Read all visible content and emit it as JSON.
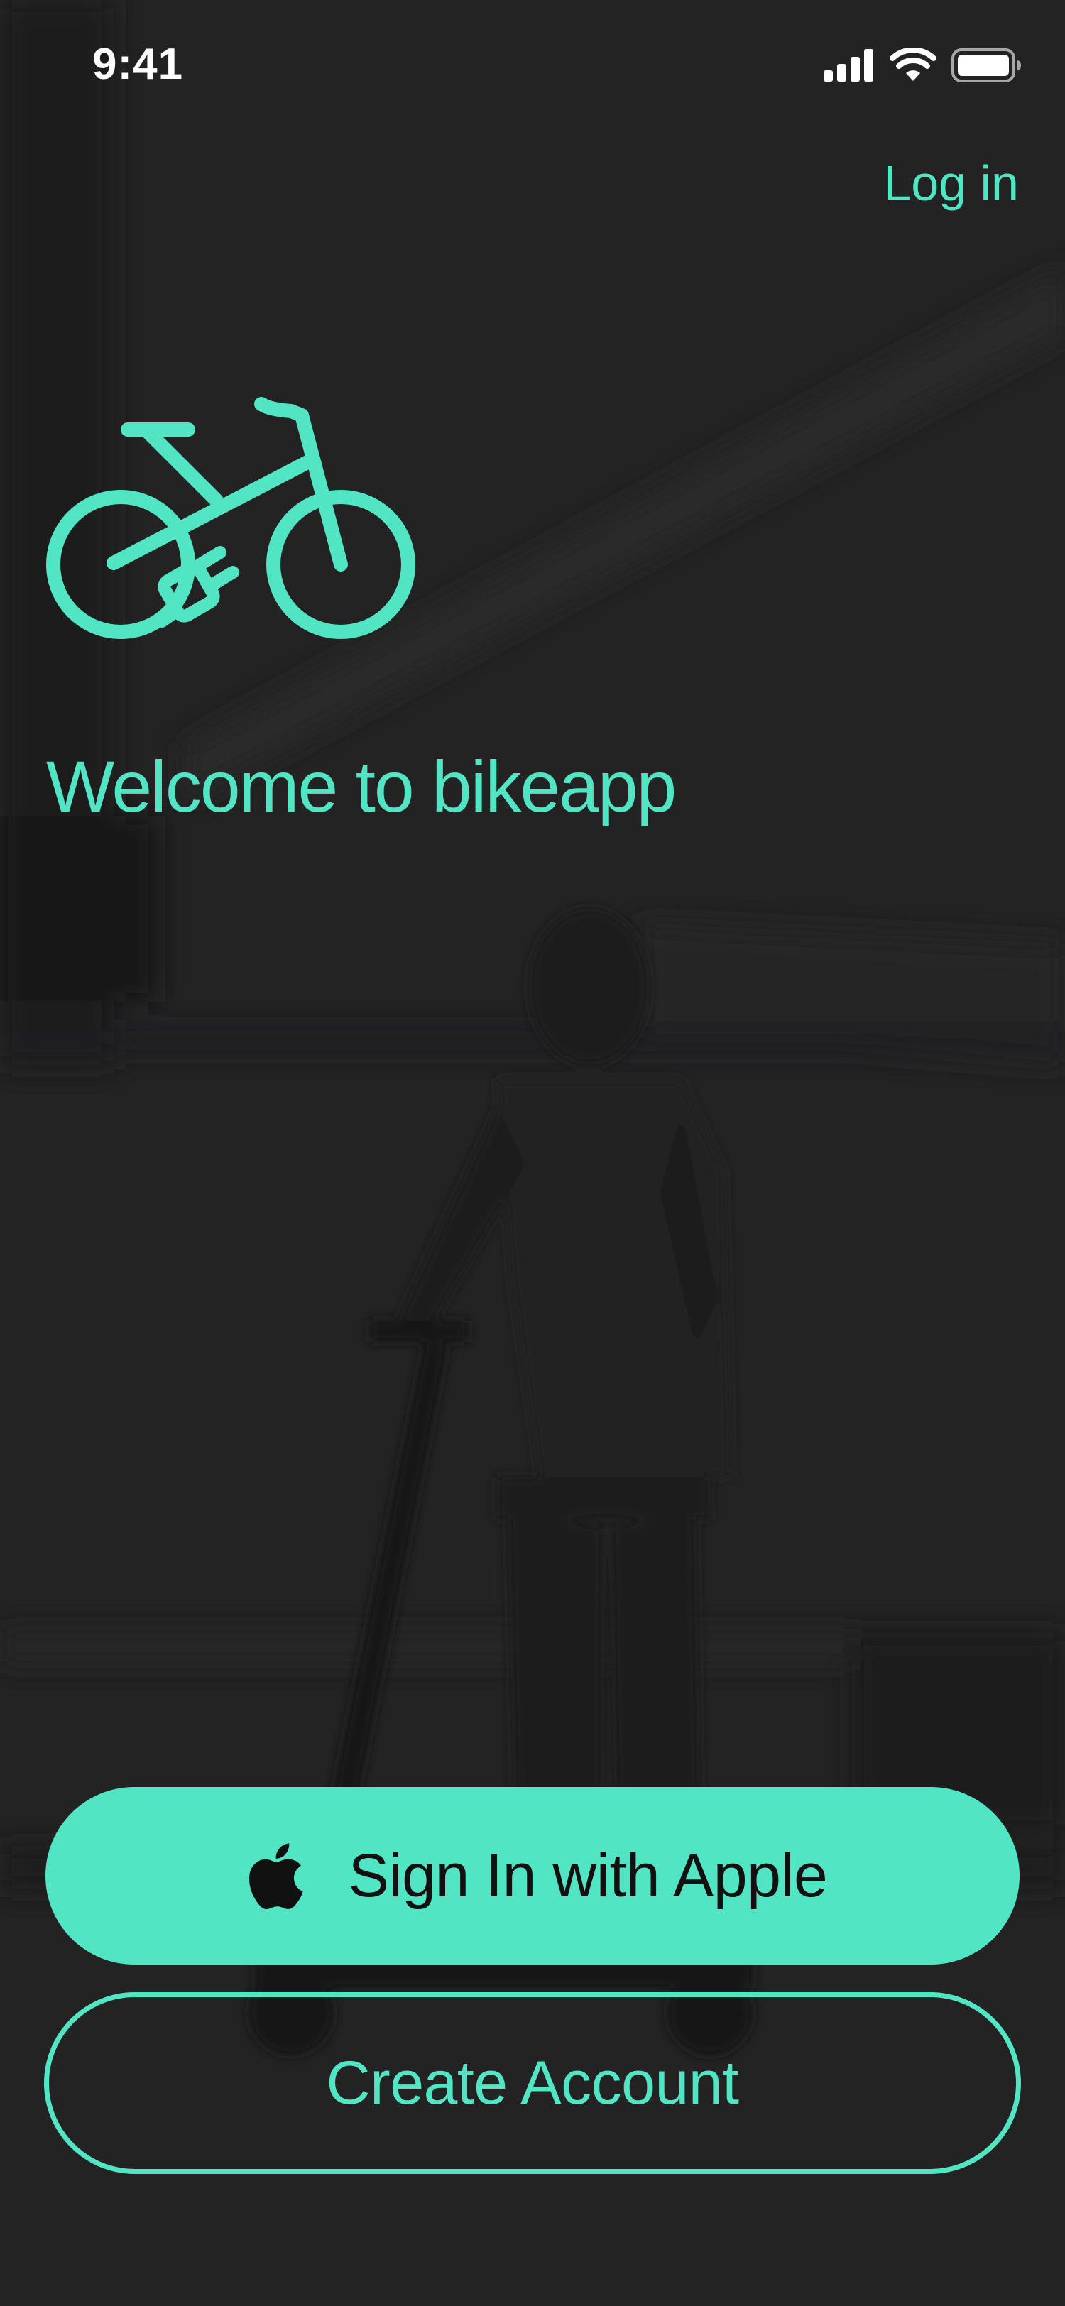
{
  "status_bar": {
    "time": "9:41",
    "icons": [
      "cellular-signal-icon",
      "wifi-icon",
      "battery-icon"
    ]
  },
  "header": {
    "login_label": "Log in"
  },
  "hero": {
    "logo_icon": "electric-bike-icon",
    "welcome_text": "Welcome to bikeapp"
  },
  "actions": {
    "apple_icon": "apple-logo-icon",
    "apple_label": "Sign In with Apple",
    "create_label": "Create Account"
  },
  "colors": {
    "accent": "#52e5c3",
    "background": "#232324",
    "status_text": "#ffffff",
    "button_text_dark": "#111111"
  }
}
